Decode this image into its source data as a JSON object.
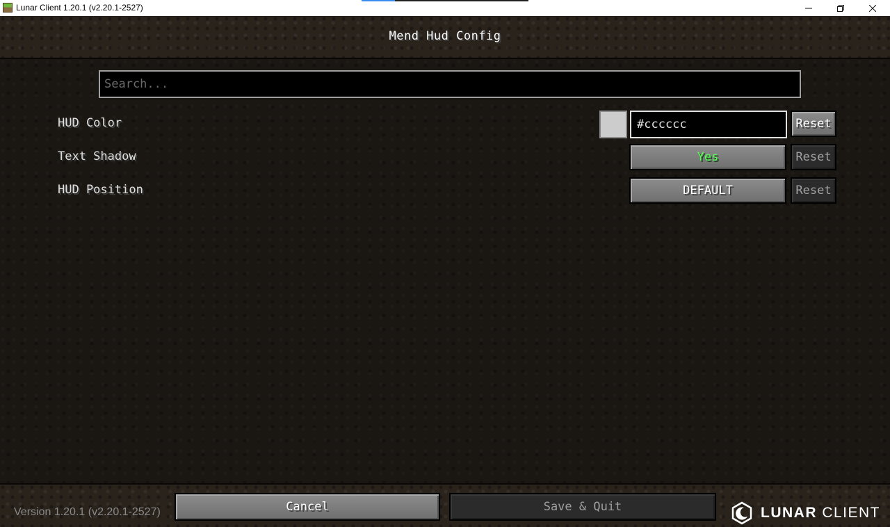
{
  "window": {
    "title": "Lunar Client 1.20.1 (v2.20.1-2527)",
    "minimize_icon": "minimize-icon",
    "maximize_icon": "restore-icon",
    "close_icon": "close-icon"
  },
  "page": {
    "title": "Mend Hud Config"
  },
  "search": {
    "placeholder": "Search..."
  },
  "settings": [
    {
      "label": "HUD Color",
      "swatch_color": "#cccccc",
      "value": "#cccccc",
      "reset_label": "Reset",
      "reset_enabled": true
    },
    {
      "label": "Text Shadow",
      "value": "Yes",
      "value_color": "#55ff55",
      "reset_label": "Reset",
      "reset_enabled": false
    },
    {
      "label": "HUD Position",
      "value": "DEFAULT",
      "reset_label": "Reset",
      "reset_enabled": false
    }
  ],
  "footer": {
    "version": "Version 1.20.1 (v2.20.1-2527)",
    "cancel_label": "Cancel",
    "save_label": "Save & Quit",
    "brand_bold": "LUNAR",
    "brand_light": " CLIENT"
  }
}
